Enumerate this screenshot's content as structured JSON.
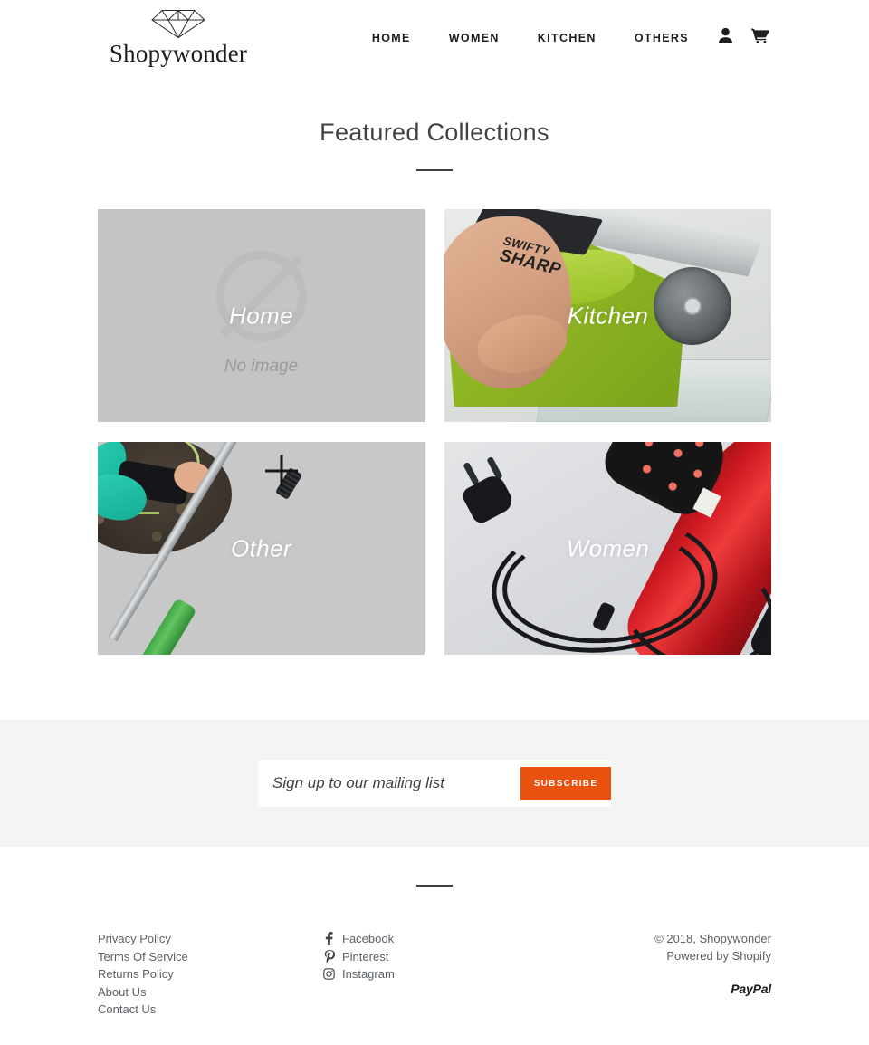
{
  "header": {
    "logo_word": "Shopywonder",
    "logo_icon": "diamond-icon",
    "nav": [
      {
        "label": "HOME"
      },
      {
        "label": "WOMEN"
      },
      {
        "label": "KITCHEN"
      },
      {
        "label": "OTHERS"
      }
    ],
    "account_icon": "user-icon",
    "cart_icon": "shopping-cart-icon"
  },
  "featured": {
    "title": "Featured Collections",
    "cards": [
      {
        "label": "Home",
        "placeholder": true,
        "no_image_text": "No image",
        "art": "placeholder"
      },
      {
        "label": "Kitchen",
        "placeholder": false,
        "art": "knife-sharpener",
        "brand_line1": "SWIFTY",
        "brand_line2": "SHARP"
      },
      {
        "label": "Other",
        "placeholder": false,
        "art": "garden-tool"
      },
      {
        "label": "Women",
        "placeholder": false,
        "art": "hair-straightener-brush"
      }
    ]
  },
  "newsletter": {
    "placeholder": "Sign up to our mailing list",
    "value": "",
    "subscribe_label": "Subscribe",
    "button_color": "#e8520e",
    "band_color": "#f4f4f4"
  },
  "footer": {
    "links": [
      {
        "label": "Privacy Policy"
      },
      {
        "label": "Terms Of Service"
      },
      {
        "label": "Returns Policy"
      },
      {
        "label": "About Us"
      },
      {
        "label": "Contact Us"
      }
    ],
    "social": [
      {
        "label": "Facebook",
        "icon": "facebook-icon",
        "glyph": "f"
      },
      {
        "label": "Pinterest",
        "icon": "pinterest-icon",
        "glyph": "P"
      },
      {
        "label": "Instagram",
        "icon": "instagram-icon",
        "glyph": "▢"
      }
    ],
    "copyright": "© 2018, Shopywonder",
    "powered_by": "Powered by Shopify",
    "payment": "PayPal"
  }
}
